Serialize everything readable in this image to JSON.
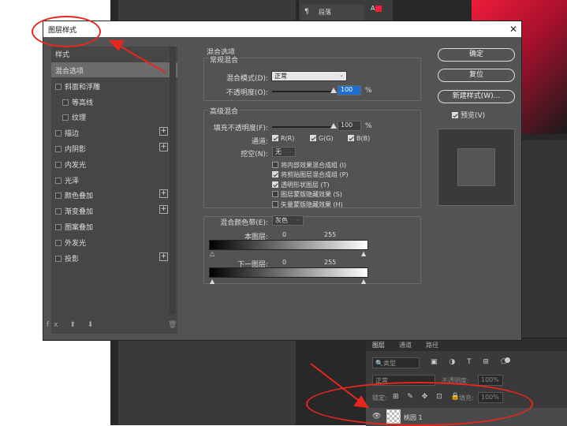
{
  "background": {
    "paragraph_panel_label": "段落",
    "paragraph_icon": "paragraph-icon",
    "aa_label": "A"
  },
  "layers_panel": {
    "tabs": [
      "图层",
      "通道",
      "路径"
    ],
    "filter_kind": "类型",
    "filter_icons": "▣ ◑ T ⊞ ⬠",
    "blend_mode": "正常",
    "opacity_label": "不透明度:",
    "opacity_value": "100%",
    "lock_label": "锁定:",
    "lock_icons": "⊞ ✎ ✥ ⊡ 🔒",
    "fill_label": "填充:",
    "fill_value": "100%",
    "layer_name": "桃园 1"
  },
  "dialog": {
    "title": "图层样式",
    "close": "✕",
    "styles_header": "样式",
    "styles": [
      {
        "label": "混合选项",
        "checkbox": false,
        "plus": false,
        "selected": true,
        "indent": false
      },
      {
        "label": "斜面和浮雕",
        "checkbox": true,
        "plus": false,
        "selected": false,
        "indent": false
      },
      {
        "label": "等高线",
        "checkbox": true,
        "plus": false,
        "selected": false,
        "indent": true
      },
      {
        "label": "纹理",
        "checkbox": true,
        "plus": false,
        "selected": false,
        "indent": true
      },
      {
        "label": "描边",
        "checkbox": true,
        "plus": true,
        "selected": false,
        "indent": false
      },
      {
        "label": "内阴影",
        "checkbox": true,
        "plus": true,
        "selected": false,
        "indent": false
      },
      {
        "label": "内发光",
        "checkbox": true,
        "plus": false,
        "selected": false,
        "indent": false
      },
      {
        "label": "光泽",
        "checkbox": true,
        "plus": false,
        "selected": false,
        "indent": false
      },
      {
        "label": "颜色叠加",
        "checkbox": true,
        "plus": true,
        "selected": false,
        "indent": false
      },
      {
        "label": "渐变叠加",
        "checkbox": true,
        "plus": true,
        "selected": false,
        "indent": false
      },
      {
        "label": "图案叠加",
        "checkbox": true,
        "plus": false,
        "selected": false,
        "indent": false
      },
      {
        "label": "外发光",
        "checkbox": true,
        "plus": false,
        "selected": false,
        "indent": false
      },
      {
        "label": "投影",
        "checkbox": true,
        "plus": true,
        "selected": false,
        "indent": false
      }
    ],
    "footer_icons": "fx ⬆ ⬇",
    "trash_icon": "🗑",
    "blend_options_title": "混合选项",
    "general_blend_title": "常规混合",
    "blend_mode_label": "混合模式(D):",
    "blend_mode_value": "正常",
    "opacity_label": "不透明度(O):",
    "opacity_value": "100",
    "opacity_percent": 100,
    "percent_sign": "%",
    "advanced_blend_title": "高级混合",
    "fill_opacity_label": "填充不透明度(F):",
    "fill_opacity_value": "100",
    "fill_opacity_percent": 100,
    "channels_label": "通道:",
    "channel_r": "R(R)",
    "channel_g": "G(G)",
    "channel_b": "B(B)",
    "knockout_label": "挖空(N):",
    "knockout_value": "无",
    "options": [
      {
        "label": "将内部效果混合成组 (I)",
        "checked": false
      },
      {
        "label": "将剪贴图层混合成组 (P)",
        "checked": true
      },
      {
        "label": "透明形状图层 (T)",
        "checked": true
      },
      {
        "label": "图层蒙版隐藏效果 (S)",
        "checked": false
      },
      {
        "label": "矢量蒙版隐藏效果 (H)",
        "checked": false
      }
    ],
    "blend_if_label": "混合颜色带(E):",
    "blend_if_value": "灰色",
    "this_layer_label": "本图层:",
    "underlying_label": "下一图层:",
    "range_min": "0",
    "range_max": "255",
    "ok_button": "确定",
    "reset_button": "复位",
    "new_style_button": "新建样式(W)...",
    "preview_label": "预览(V)"
  }
}
